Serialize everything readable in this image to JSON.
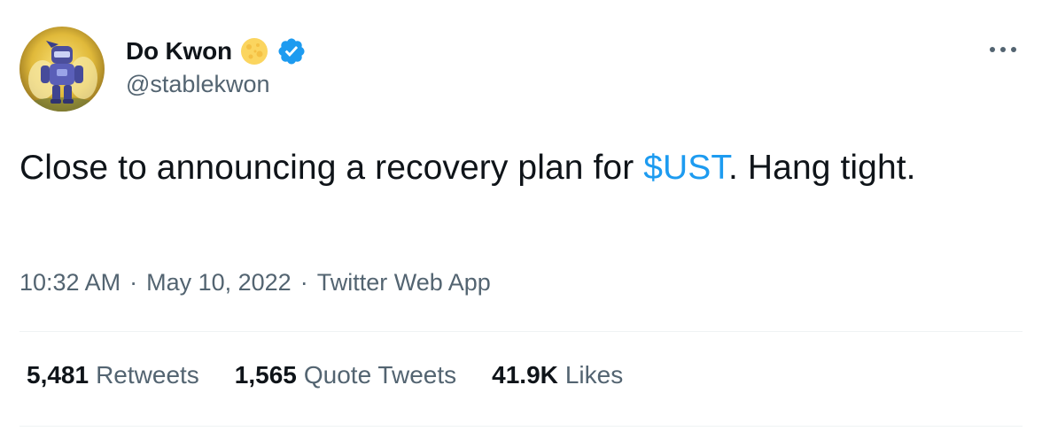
{
  "author": {
    "display_name": "Do Kwon",
    "handle": "@stablekwon",
    "avatar_icon": "robot-avatar-icon",
    "badges": [
      "moon-emoji-icon",
      "verified-badge-icon"
    ]
  },
  "tweet": {
    "text_before": "Close to announcing a recovery plan for ",
    "cashtag": "$UST",
    "text_after": ". Hang tight."
  },
  "meta": {
    "time": "10:32 AM",
    "separator": "·",
    "date": "May 10, 2022",
    "source": "Twitter Web App"
  },
  "stats": {
    "retweets_count": "5,481",
    "retweets_label": "Retweets",
    "quotes_count": "1,565",
    "quotes_label": "Quote Tweets",
    "likes_count": "41.9K",
    "likes_label": "Likes"
  },
  "more_icon": "more-options-icon",
  "colors": {
    "text": "#0f1419",
    "secondary": "#536471",
    "link": "#1d9bf0",
    "divider": "#eff3f4"
  }
}
